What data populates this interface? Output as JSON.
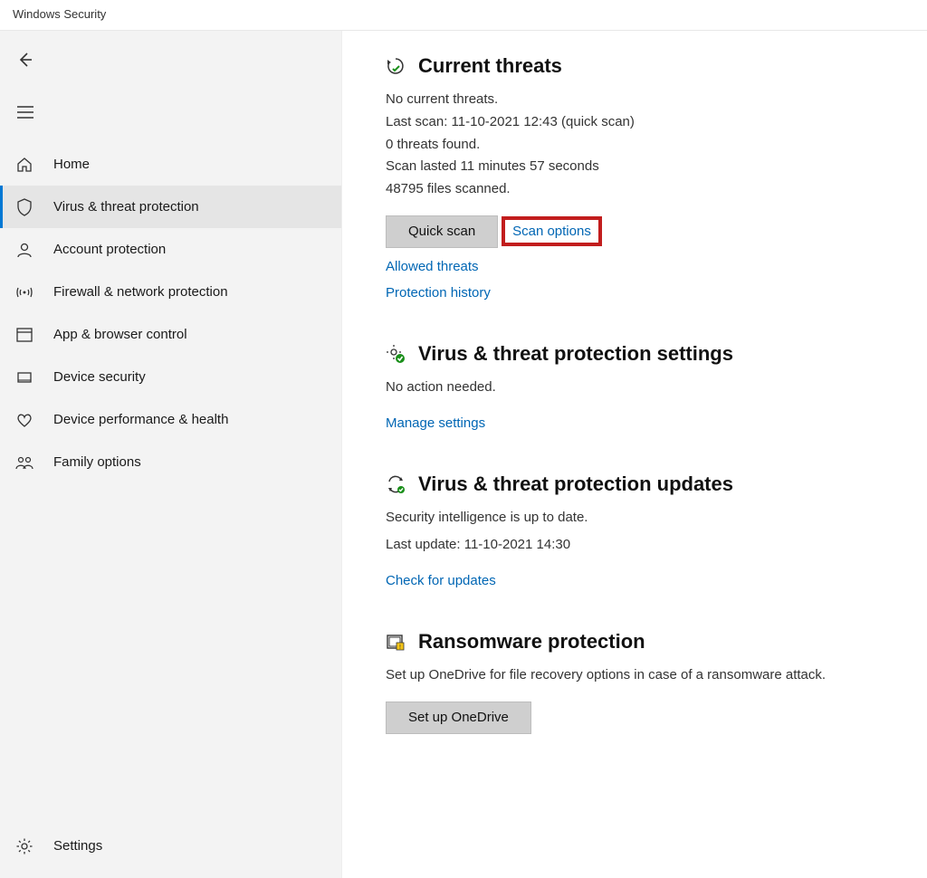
{
  "window": {
    "title": "Windows Security"
  },
  "sidebar": {
    "items": [
      {
        "label": "Home"
      },
      {
        "label": "Virus & threat protection"
      },
      {
        "label": "Account protection"
      },
      {
        "label": "Firewall & network protection"
      },
      {
        "label": "App & browser control"
      },
      {
        "label": "Device security"
      },
      {
        "label": "Device performance & health"
      },
      {
        "label": "Family options"
      }
    ],
    "settings": "Settings"
  },
  "threats": {
    "title": "Current threats",
    "no_threats": "No current threats.",
    "last_scan": "Last scan: 11-10-2021 12:43 (quick scan)",
    "found": "0 threats found.",
    "duration": "Scan lasted 11 minutes 57 seconds",
    "files": "48795 files scanned.",
    "quick_scan_btn": "Quick scan",
    "scan_options": "Scan options",
    "allowed_threats": "Allowed threats",
    "protection_history": "Protection history"
  },
  "vtsettings": {
    "title": "Virus & threat protection settings",
    "status": "No action needed.",
    "manage": "Manage settings"
  },
  "updates": {
    "title": "Virus & threat protection updates",
    "status": "Security intelligence is up to date.",
    "last_update": "Last update: 11-10-2021 14:30",
    "check": "Check for updates"
  },
  "ransomware": {
    "title": "Ransomware protection",
    "desc": "Set up OneDrive for file recovery options in case of a ransomware attack.",
    "btn": "Set up OneDrive"
  }
}
